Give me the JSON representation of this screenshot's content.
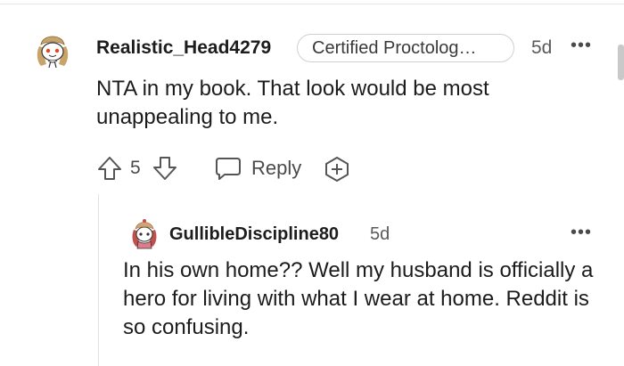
{
  "comment": {
    "author": "Realistic_Head4279",
    "flair": "Certified Proctolog…",
    "time": "5d",
    "more": "•••",
    "body": "NTA in my book. That look would be most unappealing to me.",
    "score": "5",
    "reply_label": "Reply",
    "icons": {
      "avatar": "snoo-avatar-icon",
      "upvote": "upvote-arrow-icon",
      "downvote": "downvote-arrow-icon",
      "reply": "chat-bubble-icon",
      "award": "award-plus-icon"
    }
  },
  "reply": {
    "author": "GullibleDiscipline80",
    "time": "5d",
    "more": "•••",
    "body": "In his own home?? Well my husband is officially a hero for living with what I wear at home. Reddit is so confusing.",
    "icons": {
      "avatar": "snoo-avatar-icon"
    }
  },
  "colors": {
    "text": "#1c1c1c",
    "muted": "#5a5a5a",
    "divider": "#e2e2e2"
  }
}
